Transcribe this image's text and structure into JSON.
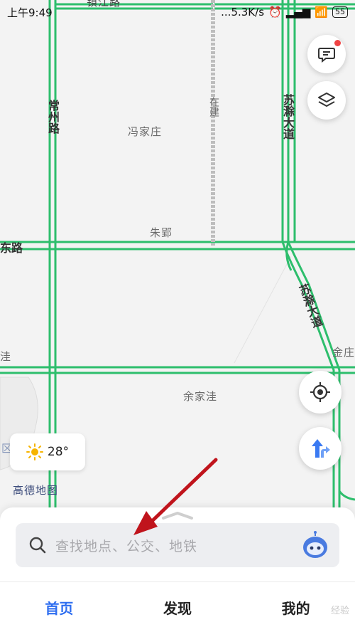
{
  "status_bar": {
    "time": "上午9:49",
    "network": "...5.3K/s",
    "battery": "55"
  },
  "map": {
    "place_labels": [
      {
        "key": "fengjiazhuang",
        "text": "冯家庄"
      },
      {
        "key": "zhuying",
        "text": "朱郢"
      },
      {
        "key": "yujiawa",
        "text": "余家洼"
      },
      {
        "key": "jinzhuang",
        "text": "金庄"
      }
    ],
    "road_labels": {
      "changzhou": "常州路",
      "suchu_top": "苏滁大道",
      "suchu_bottom": "苏滁大道",
      "east_road": "东路",
      "zaijian": "在建",
      "top_road": "镇江路",
      "left_edge": "洼",
      "left_region": "区"
    },
    "colors": {
      "road": "#2dbe6c",
      "construction": "#bdbdbd",
      "accent": "#2e6ef0",
      "arrow": "#c0141c"
    }
  },
  "weather": {
    "temperature": "28°",
    "icon": "sun-icon"
  },
  "brand": "高德地图",
  "search": {
    "placeholder": "查找地点、公交、地铁"
  },
  "tabs": [
    {
      "label": "首页",
      "active": true
    },
    {
      "label": "发现",
      "active": false
    },
    {
      "label": "我的",
      "active": false
    }
  ],
  "watermark": "经验"
}
